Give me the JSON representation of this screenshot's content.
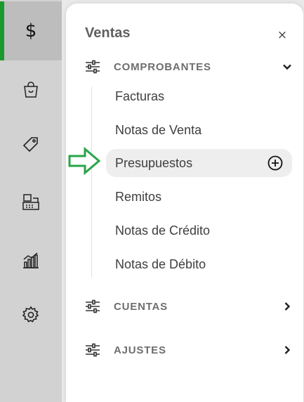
{
  "rail": {
    "items": [
      {
        "name": "ventas",
        "icon": "dollar-icon",
        "glyph": "$",
        "active": true
      },
      {
        "name": "compras",
        "icon": "shopping-bag-icon"
      },
      {
        "name": "productos",
        "icon": "tag-icon"
      },
      {
        "name": "caja",
        "icon": "cash-register-icon"
      },
      {
        "name": "reportes",
        "icon": "bar-chart-icon"
      },
      {
        "name": "configuracion",
        "icon": "gear-icon"
      }
    ]
  },
  "panel": {
    "title": "Ventas",
    "close_glyph": "×",
    "sections": [
      {
        "label": "COMPROBANTES",
        "expanded": true,
        "chevron": "chevron-down-icon"
      },
      {
        "label": "CUENTAS",
        "expanded": false,
        "chevron": "chevron-right-icon"
      },
      {
        "label": "AJUSTES",
        "expanded": false,
        "chevron": "chevron-right-icon"
      }
    ],
    "comprobantes_items": [
      "Facturas",
      "Notas de Venta",
      "Presupuestos",
      "Remitos",
      "Notas de Crédito",
      "Notas de Débito"
    ],
    "highlighted_item": "Presupuestos"
  },
  "colors": {
    "accent_green": "#1a9a2c",
    "arrow_green": "#2aa44a",
    "rail_bg": "#d2d2d2"
  }
}
